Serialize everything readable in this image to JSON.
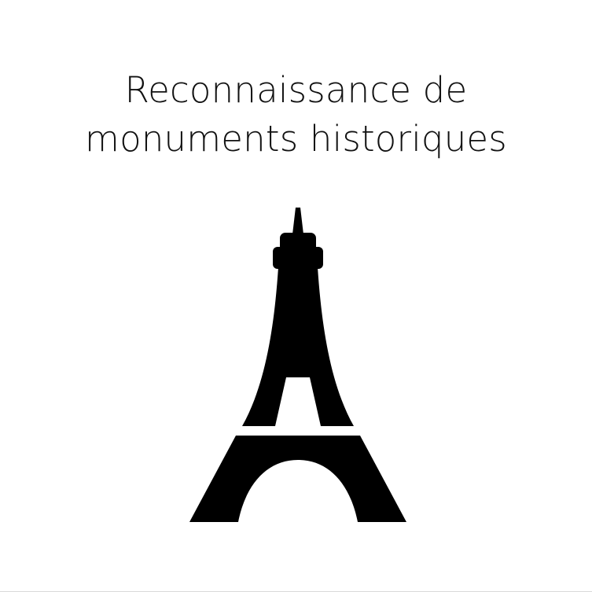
{
  "title": {
    "line1": "Reconnaissance de",
    "line2": "monuments historiques"
  },
  "illustration": {
    "icon": "eiffel-tower-icon",
    "color": "#000000"
  },
  "background": "#ffffff"
}
